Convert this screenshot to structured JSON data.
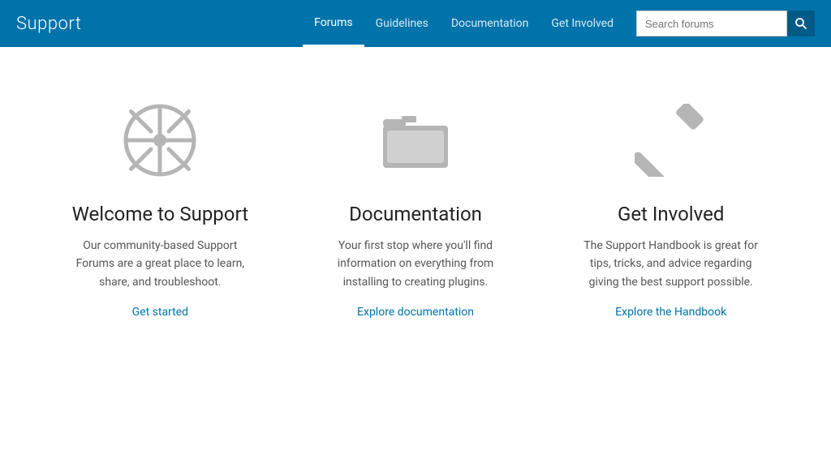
{
  "header": {
    "site_title": "Support",
    "nav": [
      {
        "label": "Forums",
        "active": true
      },
      {
        "label": "Guidelines",
        "active": false
      },
      {
        "label": "Documentation",
        "active": false
      },
      {
        "label": "Get Involved",
        "active": false
      }
    ],
    "search": {
      "placeholder": "Search forums",
      "button_icon": "search-icon"
    }
  },
  "cards": [
    {
      "icon": "wheel",
      "title": "Welcome to Support",
      "description": "Our community-based Support Forums are a great place to learn, share, and troubleshoot.",
      "link_label": "Get started",
      "link_href": "#"
    },
    {
      "icon": "folder",
      "title": "Documentation",
      "description": "Your first stop where you'll find information on everything from installing to creating plugins.",
      "link_label": "Explore documentation",
      "link_href": "#"
    },
    {
      "icon": "hammer",
      "title": "Get Involved",
      "description": "The Support Handbook is great for tips, tricks, and advice regarding giving the best support possible.",
      "link_label": "Explore the Handbook",
      "link_href": "#"
    }
  ],
  "colors": {
    "primary": "#0073aa",
    "icon_color": "#b5b5b5"
  }
}
